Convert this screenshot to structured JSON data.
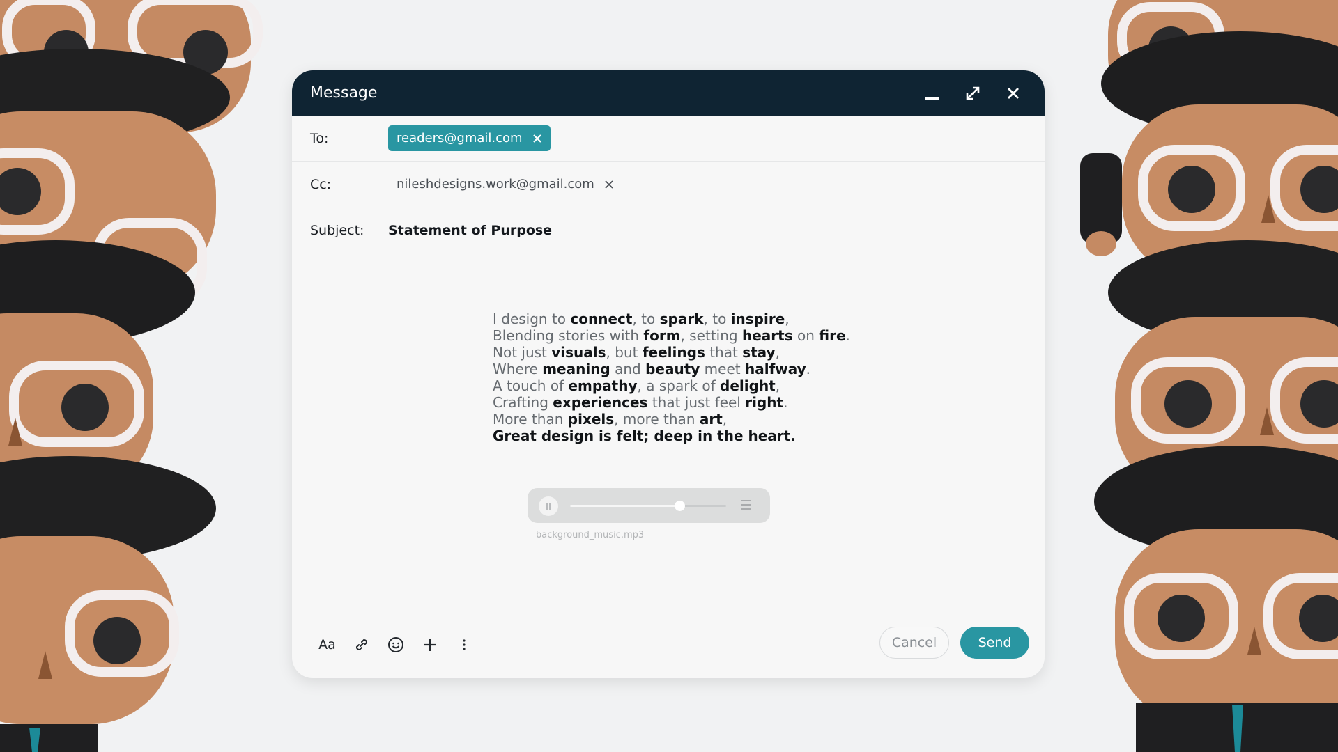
{
  "window": {
    "title": "Message"
  },
  "compose": {
    "to_label": "To:",
    "to_value": "readers@gmail.com",
    "cc_label": "Cc:",
    "cc_value": "nileshdesigns.work@gmail.com",
    "subject_label": "Subject:",
    "subject_value": "Statement of Purpose"
  },
  "body": {
    "lines": [
      [
        [
          "I design to ",
          0
        ],
        [
          "connect",
          1
        ],
        [
          ", to ",
          0
        ],
        [
          "spark",
          1
        ],
        [
          ", to ",
          0
        ],
        [
          "inspire",
          1
        ],
        [
          ",",
          0
        ]
      ],
      [
        [
          "Blending stories with ",
          0
        ],
        [
          "form",
          1
        ],
        [
          ", setting ",
          0
        ],
        [
          "hearts",
          1
        ],
        [
          " on ",
          0
        ],
        [
          "fire",
          1
        ],
        [
          ".",
          0
        ]
      ],
      [
        [
          "Not just ",
          0
        ],
        [
          "visuals",
          1
        ],
        [
          ", but ",
          0
        ],
        [
          "feelings",
          1
        ],
        [
          " that ",
          0
        ],
        [
          "stay",
          1
        ],
        [
          ",",
          0
        ]
      ],
      [
        [
          "Where ",
          0
        ],
        [
          "meaning",
          1
        ],
        [
          " and ",
          0
        ],
        [
          "beauty",
          1
        ],
        [
          " meet ",
          0
        ],
        [
          "halfway",
          1
        ],
        [
          ".",
          0
        ]
      ],
      [
        [
          "A touch of ",
          0
        ],
        [
          "empathy",
          1
        ],
        [
          ", a spark of ",
          0
        ],
        [
          "delight",
          1
        ],
        [
          ",",
          0
        ]
      ],
      [
        [
          "Crafting ",
          0
        ],
        [
          "experiences",
          1
        ],
        [
          " that just feel ",
          0
        ],
        [
          "right",
          1
        ],
        [
          ".",
          0
        ]
      ],
      [
        [
          "More than ",
          0
        ],
        [
          "pixels",
          1
        ],
        [
          ", more than ",
          0
        ],
        [
          "art",
          1
        ],
        [
          ",",
          0
        ]
      ],
      [
        [
          "Great design is felt; deep in the heart.",
          1
        ]
      ]
    ]
  },
  "audio": {
    "filename": "background_music.mp3",
    "progress": 0.7
  },
  "toolbar": {
    "format_label": "Aa"
  },
  "actions": {
    "cancel_label": "Cancel",
    "send_label": "Send"
  },
  "colors": {
    "accent": "#2996a2",
    "titlebar": "#0f2433",
    "background": "#f1f2f3"
  }
}
